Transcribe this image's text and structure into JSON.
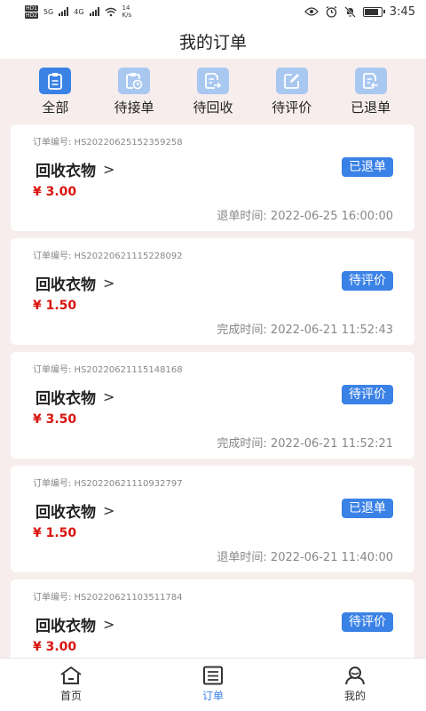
{
  "status": {
    "hd1": "HD1",
    "hd2": "HD2",
    "net1": "5G",
    "net2": "4G",
    "speed_value": "14",
    "speed_unit": "K/s",
    "time": "3:45"
  },
  "header": {
    "title": "我的订单"
  },
  "tabs": [
    {
      "label": "全部",
      "icon": "clipboard-icon",
      "active": true
    },
    {
      "label": "待接单",
      "icon": "clipboard-clock-icon",
      "active": false
    },
    {
      "label": "待回收",
      "icon": "document-export-icon",
      "active": false
    },
    {
      "label": "待评价",
      "icon": "edit-icon",
      "active": false
    },
    {
      "label": "已退单",
      "icon": "document-return-icon",
      "active": false
    }
  ],
  "orders": [
    {
      "order_no": "订单编号: HS20220625152359258",
      "title": "回收衣物",
      "price": "¥ 3.00",
      "status": "已退单",
      "time": "退单时间: 2022-06-25 16:00:00"
    },
    {
      "order_no": "订单编号: HS20220621115228092",
      "title": "回收衣物",
      "price": "¥ 1.50",
      "status": "待评价",
      "time": "完成时间: 2022-06-21 11:52:43"
    },
    {
      "order_no": "订单编号: HS20220621115148168",
      "title": "回收衣物",
      "price": "¥ 3.50",
      "status": "待评价",
      "time": "完成时间: 2022-06-21 11:52:21"
    },
    {
      "order_no": "订单编号: HS20220621110932797",
      "title": "回收衣物",
      "price": "¥ 1.50",
      "status": "已退单",
      "time": "退单时间: 2022-06-21 11:40:00"
    },
    {
      "order_no": "订单编号: HS20220621103511784",
      "title": "回收衣物",
      "price": "¥ 3.00",
      "status": "待评价",
      "time": ""
    }
  ],
  "bottom_nav": [
    {
      "label": "首页",
      "icon": "home-icon",
      "active": false
    },
    {
      "label": "订单",
      "icon": "order-list-icon",
      "active": true
    },
    {
      "label": "我的",
      "icon": "user-icon",
      "active": false
    }
  ],
  "colors": {
    "accent": "#3b82e6",
    "tab_inactive": "#a9c8f0",
    "price": "#d9140f",
    "background": "#f7eded"
  }
}
